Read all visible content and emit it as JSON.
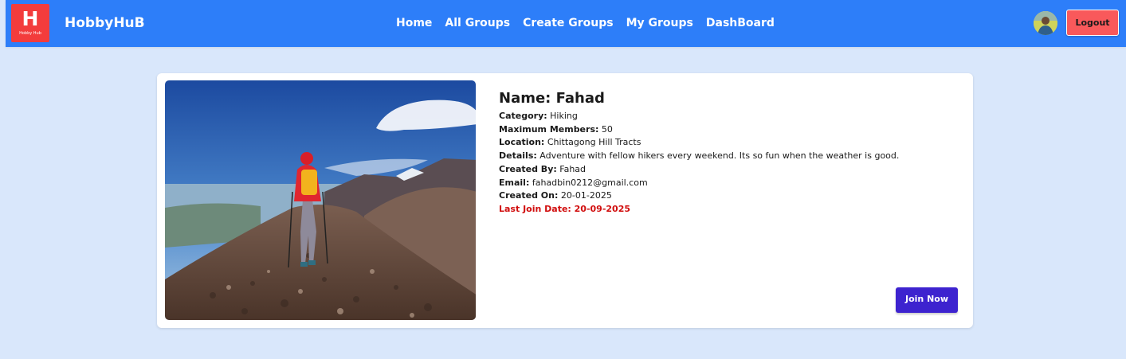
{
  "header": {
    "logo_letter": "H",
    "logo_text": "Hobby Hub",
    "brand": "HobbyHuB",
    "nav": [
      "Home",
      "All Groups",
      "Create Groups",
      "My Groups",
      "DashBoard"
    ],
    "logout_label": "Logout",
    "avatar": "user-avatar",
    "colors": {
      "navbar": "#2d7ef9",
      "logo_bg": "#f33c3c",
      "logout_bg": "#f9595b"
    }
  },
  "group": {
    "name_label": "Name:",
    "name": "Fahad",
    "fields": [
      {
        "label": "Category:",
        "value": "Hiking"
      },
      {
        "label": "Maximum Members:",
        "value": "50"
      },
      {
        "label": "Location:",
        "value": "Chittagong Hill Tracts"
      },
      {
        "label": "Details:",
        "value": "Adventure with fellow hikers every weekend. Its so fun when the weather is good."
      },
      {
        "label": "Created By:",
        "value": "Fahad"
      },
      {
        "label": "Email:",
        "value": "fahadbin0212@gmail.com"
      },
      {
        "label": "Created On:",
        "value": "20-01-2025"
      }
    ],
    "last_join": "Last Join Date: 20-09-2025",
    "join_label": "Join Now",
    "image": "hiker-on-mountain-photo",
    "colors": {
      "last_join": "#d10e0e",
      "join_button": "#3d23cf"
    }
  }
}
